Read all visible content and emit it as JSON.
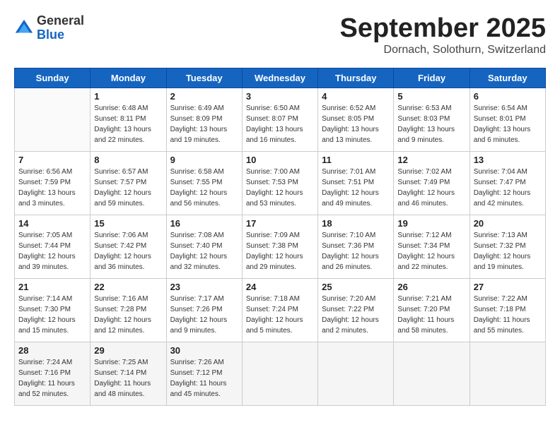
{
  "header": {
    "logo_general": "General",
    "logo_blue": "Blue",
    "month_title": "September 2025",
    "location": "Dornach, Solothurn, Switzerland"
  },
  "weekdays": [
    "Sunday",
    "Monday",
    "Tuesday",
    "Wednesday",
    "Thursday",
    "Friday",
    "Saturday"
  ],
  "weeks": [
    [
      {
        "day": "",
        "sunrise": "",
        "sunset": "",
        "daylight": ""
      },
      {
        "day": "1",
        "sunrise": "Sunrise: 6:48 AM",
        "sunset": "Sunset: 8:11 PM",
        "daylight": "Daylight: 13 hours and 22 minutes."
      },
      {
        "day": "2",
        "sunrise": "Sunrise: 6:49 AM",
        "sunset": "Sunset: 8:09 PM",
        "daylight": "Daylight: 13 hours and 19 minutes."
      },
      {
        "day": "3",
        "sunrise": "Sunrise: 6:50 AM",
        "sunset": "Sunset: 8:07 PM",
        "daylight": "Daylight: 13 hours and 16 minutes."
      },
      {
        "day": "4",
        "sunrise": "Sunrise: 6:52 AM",
        "sunset": "Sunset: 8:05 PM",
        "daylight": "Daylight: 13 hours and 13 minutes."
      },
      {
        "day": "5",
        "sunrise": "Sunrise: 6:53 AM",
        "sunset": "Sunset: 8:03 PM",
        "daylight": "Daylight: 13 hours and 9 minutes."
      },
      {
        "day": "6",
        "sunrise": "Sunrise: 6:54 AM",
        "sunset": "Sunset: 8:01 PM",
        "daylight": "Daylight: 13 hours and 6 minutes."
      }
    ],
    [
      {
        "day": "7",
        "sunrise": "Sunrise: 6:56 AM",
        "sunset": "Sunset: 7:59 PM",
        "daylight": "Daylight: 13 hours and 3 minutes."
      },
      {
        "day": "8",
        "sunrise": "Sunrise: 6:57 AM",
        "sunset": "Sunset: 7:57 PM",
        "daylight": "Daylight: 12 hours and 59 minutes."
      },
      {
        "day": "9",
        "sunrise": "Sunrise: 6:58 AM",
        "sunset": "Sunset: 7:55 PM",
        "daylight": "Daylight: 12 hours and 56 minutes."
      },
      {
        "day": "10",
        "sunrise": "Sunrise: 7:00 AM",
        "sunset": "Sunset: 7:53 PM",
        "daylight": "Daylight: 12 hours and 53 minutes."
      },
      {
        "day": "11",
        "sunrise": "Sunrise: 7:01 AM",
        "sunset": "Sunset: 7:51 PM",
        "daylight": "Daylight: 12 hours and 49 minutes."
      },
      {
        "day": "12",
        "sunrise": "Sunrise: 7:02 AM",
        "sunset": "Sunset: 7:49 PM",
        "daylight": "Daylight: 12 hours and 46 minutes."
      },
      {
        "day": "13",
        "sunrise": "Sunrise: 7:04 AM",
        "sunset": "Sunset: 7:47 PM",
        "daylight": "Daylight: 12 hours and 42 minutes."
      }
    ],
    [
      {
        "day": "14",
        "sunrise": "Sunrise: 7:05 AM",
        "sunset": "Sunset: 7:44 PM",
        "daylight": "Daylight: 12 hours and 39 minutes."
      },
      {
        "day": "15",
        "sunrise": "Sunrise: 7:06 AM",
        "sunset": "Sunset: 7:42 PM",
        "daylight": "Daylight: 12 hours and 36 minutes."
      },
      {
        "day": "16",
        "sunrise": "Sunrise: 7:08 AM",
        "sunset": "Sunset: 7:40 PM",
        "daylight": "Daylight: 12 hours and 32 minutes."
      },
      {
        "day": "17",
        "sunrise": "Sunrise: 7:09 AM",
        "sunset": "Sunset: 7:38 PM",
        "daylight": "Daylight: 12 hours and 29 minutes."
      },
      {
        "day": "18",
        "sunrise": "Sunrise: 7:10 AM",
        "sunset": "Sunset: 7:36 PM",
        "daylight": "Daylight: 12 hours and 26 minutes."
      },
      {
        "day": "19",
        "sunrise": "Sunrise: 7:12 AM",
        "sunset": "Sunset: 7:34 PM",
        "daylight": "Daylight: 12 hours and 22 minutes."
      },
      {
        "day": "20",
        "sunrise": "Sunrise: 7:13 AM",
        "sunset": "Sunset: 7:32 PM",
        "daylight": "Daylight: 12 hours and 19 minutes."
      }
    ],
    [
      {
        "day": "21",
        "sunrise": "Sunrise: 7:14 AM",
        "sunset": "Sunset: 7:30 PM",
        "daylight": "Daylight: 12 hours and 15 minutes."
      },
      {
        "day": "22",
        "sunrise": "Sunrise: 7:16 AM",
        "sunset": "Sunset: 7:28 PM",
        "daylight": "Daylight: 12 hours and 12 minutes."
      },
      {
        "day": "23",
        "sunrise": "Sunrise: 7:17 AM",
        "sunset": "Sunset: 7:26 PM",
        "daylight": "Daylight: 12 hours and 9 minutes."
      },
      {
        "day": "24",
        "sunrise": "Sunrise: 7:18 AM",
        "sunset": "Sunset: 7:24 PM",
        "daylight": "Daylight: 12 hours and 5 minutes."
      },
      {
        "day": "25",
        "sunrise": "Sunrise: 7:20 AM",
        "sunset": "Sunset: 7:22 PM",
        "daylight": "Daylight: 12 hours and 2 minutes."
      },
      {
        "day": "26",
        "sunrise": "Sunrise: 7:21 AM",
        "sunset": "Sunset: 7:20 PM",
        "daylight": "Daylight: 11 hours and 58 minutes."
      },
      {
        "day": "27",
        "sunrise": "Sunrise: 7:22 AM",
        "sunset": "Sunset: 7:18 PM",
        "daylight": "Daylight: 11 hours and 55 minutes."
      }
    ],
    [
      {
        "day": "28",
        "sunrise": "Sunrise: 7:24 AM",
        "sunset": "Sunset: 7:16 PM",
        "daylight": "Daylight: 11 hours and 52 minutes."
      },
      {
        "day": "29",
        "sunrise": "Sunrise: 7:25 AM",
        "sunset": "Sunset: 7:14 PM",
        "daylight": "Daylight: 11 hours and 48 minutes."
      },
      {
        "day": "30",
        "sunrise": "Sunrise: 7:26 AM",
        "sunset": "Sunset: 7:12 PM",
        "daylight": "Daylight: 11 hours and 45 minutes."
      },
      {
        "day": "",
        "sunrise": "",
        "sunset": "",
        "daylight": ""
      },
      {
        "day": "",
        "sunrise": "",
        "sunset": "",
        "daylight": ""
      },
      {
        "day": "",
        "sunrise": "",
        "sunset": "",
        "daylight": ""
      },
      {
        "day": "",
        "sunrise": "",
        "sunset": "",
        "daylight": ""
      }
    ]
  ]
}
